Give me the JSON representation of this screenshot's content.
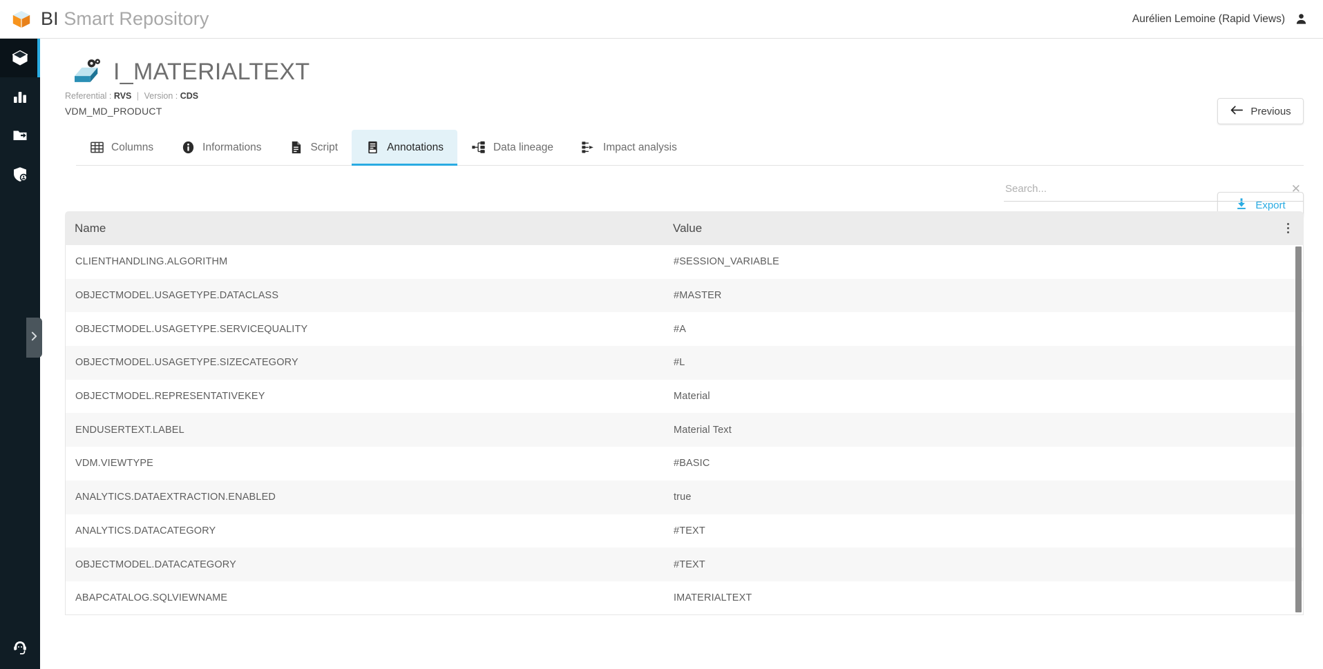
{
  "topbar": {
    "brand_bi": "BI",
    "brand_rest": " Smart Repository",
    "logo_icon": "cube-logo-icon",
    "user_name": "Aurélien Lemoine (Rapid Views)",
    "user_icon": "user-avatar-icon"
  },
  "sidebar": {
    "items": [
      {
        "icon": "cube-icon",
        "name": "sidebar-item-repository",
        "active": true
      },
      {
        "icon": "bar-chart-icon",
        "name": "sidebar-item-analytics",
        "active": false
      },
      {
        "icon": "folder-arrow-icon",
        "name": "sidebar-item-projects",
        "active": false
      },
      {
        "icon": "shield-icon",
        "name": "sidebar-item-security",
        "active": false
      }
    ],
    "bottom_icon": "headset-support-icon",
    "expand_handle_icon": "chevron-right-icon"
  },
  "page": {
    "object_icon": "cds-view-icon",
    "title": "I_MATERIALTEXT",
    "referential_label": "Referential :",
    "referential_value": "RVS",
    "separator": "|",
    "version_label": "Version :",
    "version_value": "CDS",
    "package": "VDM_MD_PRODUCT"
  },
  "buttons": {
    "previous_label": "Previous",
    "previous_icon": "arrow-left-icon",
    "export_label": "Export",
    "export_icon": "download-icon"
  },
  "tabs": [
    {
      "label": "Columns",
      "icon": "grid-icon",
      "active": false
    },
    {
      "label": "Informations",
      "icon": "info-icon",
      "active": false
    },
    {
      "label": "Script",
      "icon": "document-icon",
      "active": false
    },
    {
      "label": "Annotations",
      "icon": "annotation-icon",
      "active": true
    },
    {
      "label": "Data lineage",
      "icon": "lineage-icon",
      "active": false
    },
    {
      "label": "Impact analysis",
      "icon": "impact-icon",
      "active": false
    }
  ],
  "search": {
    "placeholder": "Search...",
    "value": "",
    "clear_icon": "close-icon"
  },
  "table": {
    "columns": [
      "Name",
      "Value"
    ],
    "menu_icon": "kebab-menu-icon",
    "rows": [
      {
        "name": "CLIENTHANDLING.ALGORITHM",
        "value": "#SESSION_VARIABLE"
      },
      {
        "name": "OBJECTMODEL.USAGETYPE.DATACLASS",
        "value": "#MASTER"
      },
      {
        "name": "OBJECTMODEL.USAGETYPE.SERVICEQUALITY",
        "value": "#A"
      },
      {
        "name": "OBJECTMODEL.USAGETYPE.SIZECATEGORY",
        "value": "#L"
      },
      {
        "name": "OBJECTMODEL.REPRESENTATIVEKEY",
        "value": "Material"
      },
      {
        "name": "ENDUSERTEXT.LABEL",
        "value": "Material Text"
      },
      {
        "name": "VDM.VIEWTYPE",
        "value": "#BASIC"
      },
      {
        "name": "ANALYTICS.DATAEXTRACTION.ENABLED",
        "value": "true"
      },
      {
        "name": "ANALYTICS.DATACATEGORY",
        "value": "#TEXT"
      },
      {
        "name": "OBJECTMODEL.DATACATEGORY",
        "value": "#TEXT"
      },
      {
        "name": "ABAPCATALOG.SQLVIEWNAME",
        "value": "IMATERIALTEXT"
      }
    ]
  },
  "colors": {
    "accent": "#29abe2",
    "rail_bg": "#101d25",
    "active_tab_bg": "#e3f2f8",
    "header_bg": "#ececec",
    "logo_orange": "#f7941e"
  }
}
